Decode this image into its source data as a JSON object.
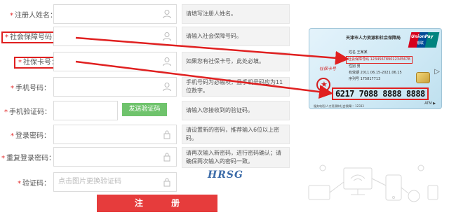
{
  "form": {
    "rows": [
      {
        "label": "注册人姓名：",
        "hint": "请填写注册人姓名。"
      },
      {
        "label": "社会保障号码：",
        "hint": "请输入社会保障号码。"
      },
      {
        "label": "社保卡号：",
        "hint": "如果您有社保卡号，此处必填。"
      },
      {
        "label": "手机号码：",
        "hint": "手机号码为必输项，且手机号码应为11位数字。"
      },
      {
        "label": "手机验证码：",
        "hint": "请输入您接收到的验证码。",
        "button": "发送验证码"
      },
      {
        "label": "登录密码：",
        "hint": "请设置新的密码，推荐输入6位以上密码。"
      },
      {
        "label": "重复登录密码：",
        "hint": "请再次输入新密码，进行密码确认；请确保两次输入的密码一致。"
      },
      {
        "label": "验证码：",
        "placeholder": "点击图片更换验证码",
        "captcha": "HRSG"
      }
    ],
    "required_mark": "*",
    "submit_label": "注 册"
  },
  "card": {
    "title": "天津市人力资源和社会保障局",
    "brand": "UnionPay",
    "brand_cn": "银联",
    "name_line": "姓名  王某某",
    "ssn_line": "社会保障号码 123456789012345678",
    "gender_line": "性别  男",
    "valid_line": "有效期 2011.06.15-2021.06.15",
    "serial_line": "序列号 175817713",
    "red_text": "社保卡号",
    "card_number": "6217 7088 8888 8888",
    "bottom_text": "服务电话(人力资源和社会保障)：12333",
    "atm": "ATM ▶",
    "arrow": "▷"
  },
  "colors": {
    "accent": "#e63c3c",
    "send_button": "#6fc36c",
    "highlight": "#e02020"
  }
}
